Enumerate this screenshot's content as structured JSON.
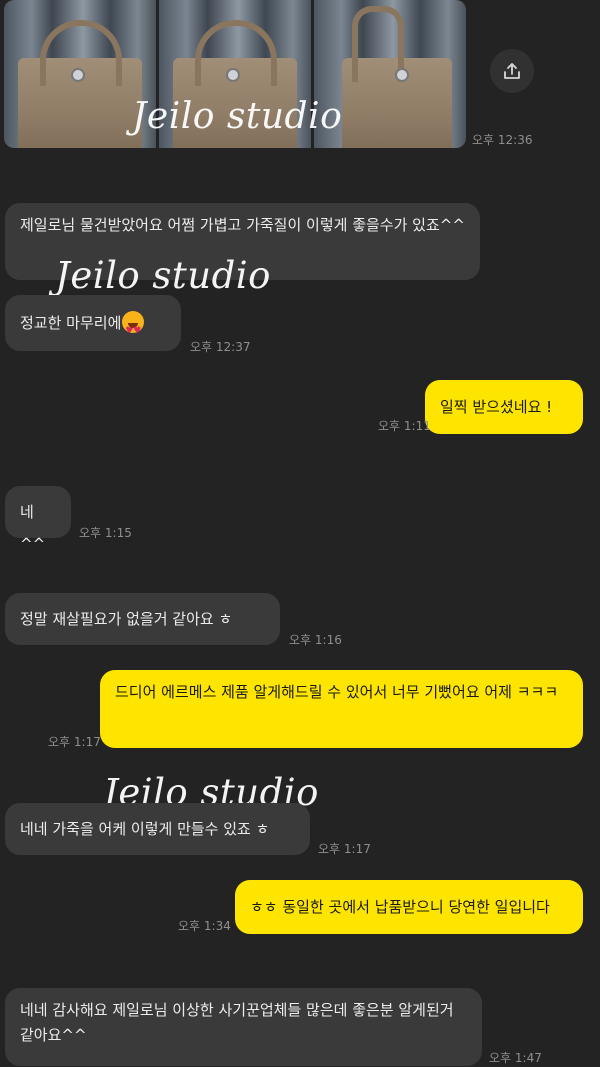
{
  "photo_watermark": "Jeilo studio",
  "photo_time": "오후 12:36",
  "watermarks": [
    "Jeilo studio",
    "Jeilo studio"
  ],
  "emoji": "heart-eyes-emoji",
  "messages": [
    {
      "side": "in",
      "text": "제일로님 물건받았어요 어쩜 가볍고 가죽질이 이렇게 좋을수가 있죠^^",
      "time": ""
    },
    {
      "side": "in",
      "text": "정교한 마무리에",
      "time": "오후 12:37"
    },
    {
      "side": "out",
      "text": "일찍 받으셨네요 !",
      "time": "오후 1:11"
    },
    {
      "side": "in",
      "text": "네^^",
      "time": "오후 1:15"
    },
    {
      "side": "in",
      "text": "정말 재살필요가 없을거 같아요 ㅎ",
      "time": "오후 1:16"
    },
    {
      "side": "out",
      "text": "드디어 에르메스 제품 알게해드릴 수 있어서 너무 기뻤어요 어제 ㅋㅋㅋ",
      "time": "오후 1:17"
    },
    {
      "side": "in",
      "text": "네네 가죽을 어케 이렇게 만들수 있죠 ㅎ",
      "time": "오후 1:17"
    },
    {
      "side": "out",
      "text": "ㅎㅎ 동일한 곳에서 납품받으니 당연한 일입니다",
      "time": "오후 1:34"
    },
    {
      "side": "in",
      "text": "네네 감사해요 제일로님 이상한 사기꾼업체들 많은데 좋은분 알게된거 같아요^^",
      "time": "오후 1:47"
    }
  ]
}
